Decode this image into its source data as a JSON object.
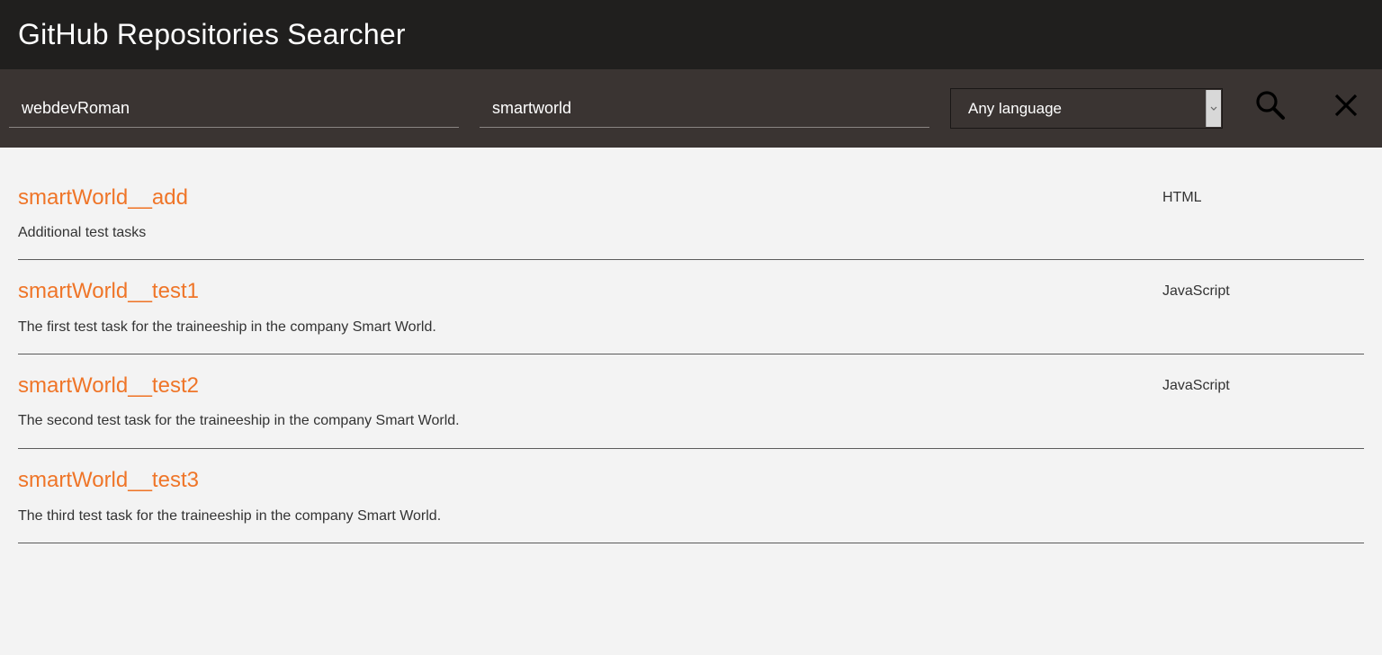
{
  "header": {
    "title": "GitHub Repositories Searcher"
  },
  "search": {
    "user_value": "webdevRoman",
    "repo_value": "smartworld",
    "language_selected": "Any language",
    "search_icon": "search-icon",
    "clear_icon": "close-icon"
  },
  "repos": [
    {
      "name": "smartWorld__add",
      "description": "Additional test tasks",
      "language": "HTML"
    },
    {
      "name": "smartWorld__test1",
      "description": "The first test task for the traineeship in the company Smart World.",
      "language": "JavaScript"
    },
    {
      "name": "smartWorld__test2",
      "description": "The second test task for the traineeship in the company Smart World.",
      "language": "JavaScript"
    },
    {
      "name": "smartWorld__test3",
      "description": "The third test task for the traineeship in the company Smart World.",
      "language": ""
    }
  ],
  "colors": {
    "accent": "#ef7528",
    "header_bg": "#201f1e",
    "searchbar_bg": "#3a3432",
    "page_bg": "#f3f3f3"
  }
}
